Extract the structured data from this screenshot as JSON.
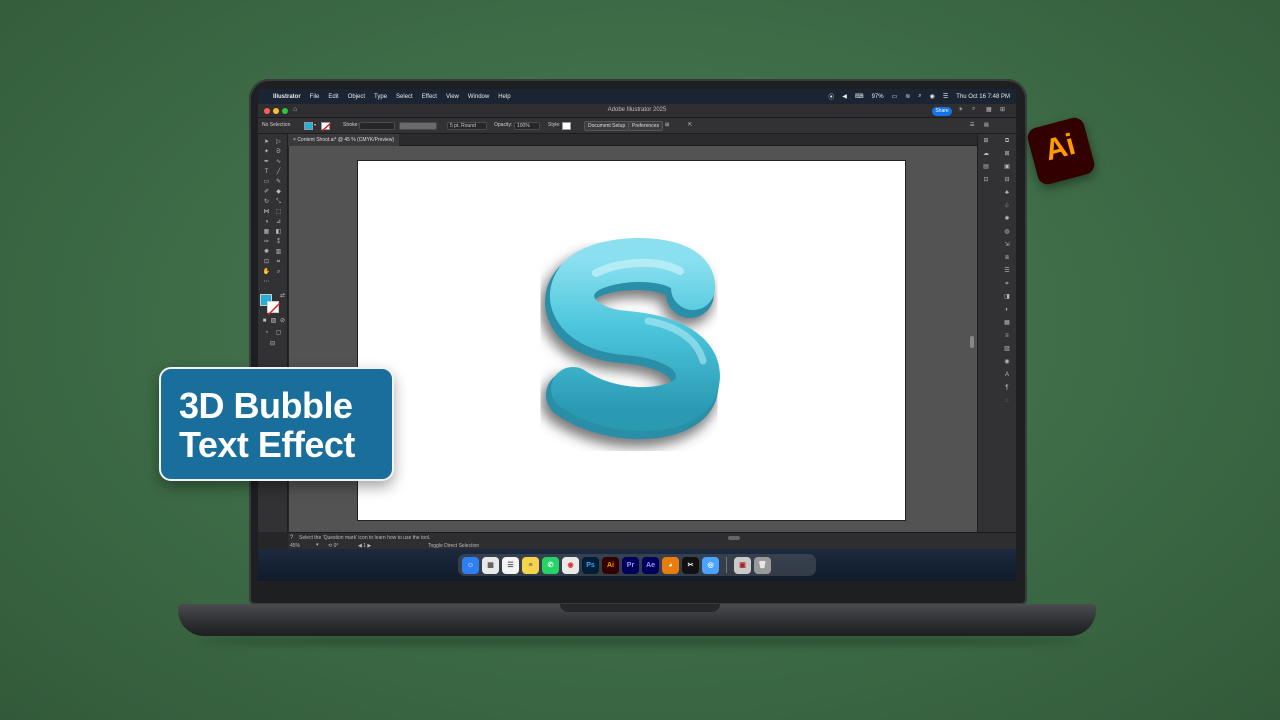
{
  "menubar": {
    "app_name": "Illustrator",
    "items": [
      "File",
      "Edit",
      "Object",
      "Type",
      "Select",
      "Effect",
      "View",
      "Window",
      "Help"
    ],
    "battery": "97%",
    "clock": "Thu Oct 16  7:48 PM"
  },
  "titlebar": {
    "title": "Adobe Illustrator 2025",
    "share_label": "Share"
  },
  "control_bar": {
    "selection": "No Selection",
    "stroke_label": "Stroke:",
    "brush": "5 pt. Round",
    "opacity_label": "Opacity:",
    "opacity_value": "100%",
    "style_label": "Style:",
    "document_setup": "Document Setup",
    "preferences": "Preferences"
  },
  "document_tab": {
    "label": "Content Shoot.ai* @ 45 % (CMYK/Preview)"
  },
  "status": {
    "hint": "Select the 'Question mark' icon to learn how to use the tool.",
    "zoom": "45%",
    "tool": "Toggle Direct Selection"
  },
  "dock": {
    "apps": [
      {
        "name": "Finder",
        "glyph": "",
        "color": "#2e7ff2"
      },
      {
        "name": "Calendar",
        "glyph": "",
        "color": "#eaeaea"
      },
      {
        "name": "Reminders",
        "glyph": "",
        "color": "#f5f5f5"
      },
      {
        "name": "Notes",
        "glyph": "",
        "color": "#f5d34c"
      },
      {
        "name": "WhatsApp",
        "glyph": "✆",
        "color": "#25d366"
      },
      {
        "name": "Chrome",
        "glyph": "",
        "color": "#e9e9e9"
      },
      {
        "name": "Photoshop",
        "glyph": "Ps",
        "color": "#001e36"
      },
      {
        "name": "Illustrator",
        "glyph": "Ai",
        "color": "#330000"
      },
      {
        "name": "Premiere Pro",
        "glyph": "Pr",
        "color": "#00005b"
      },
      {
        "name": "After Effects",
        "glyph": "Ae",
        "color": "#00005b"
      },
      {
        "name": "Blender",
        "glyph": "",
        "color": "#e87d0d"
      },
      {
        "name": "CapCut",
        "glyph": "",
        "color": "#111"
      },
      {
        "name": "QuickTime",
        "glyph": "",
        "color": "#4aa3ff"
      },
      {
        "name": "Preview",
        "glyph": "",
        "color": "#c9c9c9"
      },
      {
        "name": "Trash",
        "glyph": "",
        "color": "#9a9a9a"
      }
    ]
  },
  "badge": {
    "line1": "3D Bubble",
    "line2": "Text Effect"
  },
  "ai_logo": {
    "text": "Ai"
  },
  "colors": {
    "fill_swatch": "#22b0d8",
    "bubble_main": "#4cc6dc",
    "accent_blue": "#1473e6"
  }
}
